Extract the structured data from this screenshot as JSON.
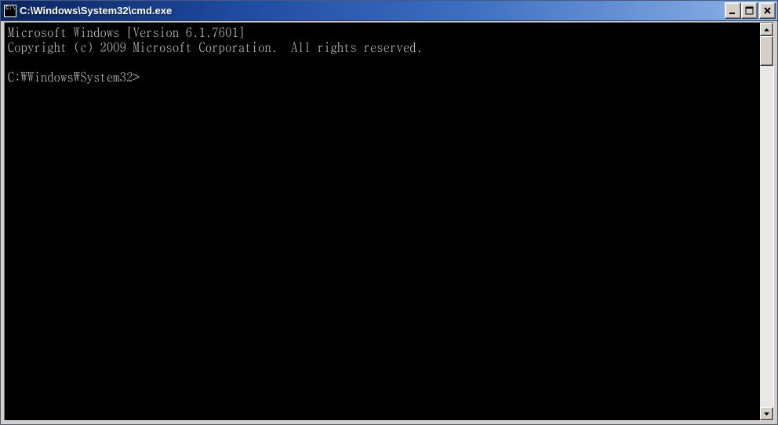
{
  "window": {
    "title": "C:\\Windows\\System32\\cmd.exe"
  },
  "console": {
    "line1": "Microsoft Windows [Version 6.1.7601]",
    "line2": "Copyright (c) 2009 Microsoft Corporation.  All rights reserved.",
    "blank": "",
    "prompt": "C:\\Windows\\System32>"
  }
}
